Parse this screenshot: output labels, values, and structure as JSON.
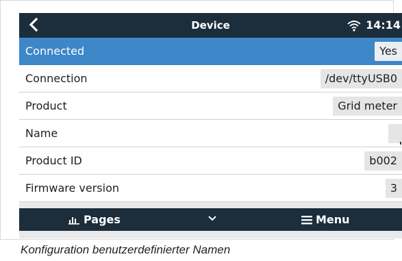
{
  "header": {
    "title": "Device",
    "time": "14:14",
    "back_icon": "chevron-left-icon",
    "wifi_icon": "wifi-icon"
  },
  "rows": [
    {
      "label": "Connected",
      "value": "Yes",
      "selected": true
    },
    {
      "label": "Connection",
      "value": "/dev/ttyUSB0"
    },
    {
      "label": "Product",
      "value": "Grid meter"
    },
    {
      "label": "Name",
      "value": ""
    },
    {
      "label": "Product ID",
      "value": "b002"
    },
    {
      "label": "Firmware version",
      "value": "3"
    }
  ],
  "footer": {
    "pages_label": "Pages",
    "menu_label": "Menu",
    "pages_icon": "bar-chart-icon",
    "chevron_icon": "chevron-down-icon",
    "menu_icon": "hamburger-icon"
  },
  "caption": "Konfiguration benutzerdefinierter Namen",
  "colors": {
    "bar_bg": "#1c2d3b",
    "selected_row": "#3d86c8",
    "value_bg": "#e5e5e5"
  }
}
